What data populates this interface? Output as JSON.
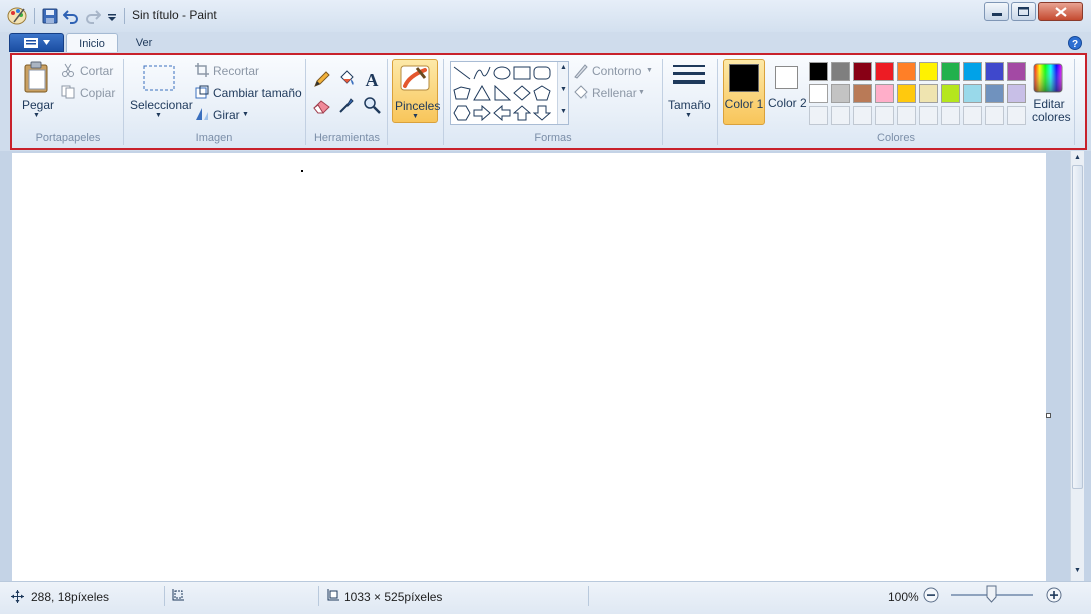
{
  "window": {
    "title": "Sin título - Paint",
    "minimize_icon": "minimize-icon",
    "maximize_icon": "maximize-icon",
    "close_icon": "close-icon"
  },
  "quick_access": [
    "save-icon",
    "undo-icon",
    "redo-icon",
    "customize-dropdown-icon"
  ],
  "tabs": [
    {
      "label": "Inicio",
      "active": true
    },
    {
      "label": "Ver",
      "active": false
    }
  ],
  "ribbon": {
    "portapapeles": {
      "label": "Portapapeles",
      "pegar": "Pegar",
      "cortar": "Cortar",
      "copiar": "Copiar"
    },
    "imagen": {
      "label": "Imagen",
      "seleccionar": "Seleccionar",
      "recortar": "Recortar",
      "cambiar_tamano": "Cambiar tamaño",
      "girar": "Girar"
    },
    "herramientas": {
      "label": "Herramientas",
      "tools": [
        "pencil-icon",
        "fill-bucket-icon",
        "text-icon",
        "eraser-icon",
        "color-picker-icon",
        "magnifier-icon"
      ]
    },
    "pinceles": {
      "label": "Pinceles"
    },
    "formas": {
      "label": "Formas",
      "contorno": "Contorno",
      "rellenar": "Rellenar",
      "shapes": [
        "line",
        "curve",
        "oval",
        "rectangle",
        "rounded-rectangle",
        "polygon",
        "triangle",
        "right-triangle",
        "diamond",
        "pentagon",
        "hexagon",
        "right-arrow",
        "left-arrow",
        "up-arrow",
        "down-arrow"
      ]
    },
    "tamano": {
      "label": "Tamaño"
    },
    "colores": {
      "label": "Colores",
      "color1": "Color 1",
      "color2": "Color 2",
      "editar": "Editar colores",
      "color1_value": "#000000",
      "color2_value": "#ffffff",
      "palette_row1": [
        "#000000",
        "#7f7f7f",
        "#880015",
        "#ed1c24",
        "#ff7f27",
        "#fff200",
        "#22b14c",
        "#00a2e8",
        "#3f48cc",
        "#a349a4"
      ],
      "palette_row2": [
        "#ffffff",
        "#c3c3c3",
        "#b97a57",
        "#ffaec9",
        "#ffc90e",
        "#efe4b0",
        "#b5e61d",
        "#99d9ea",
        "#7092be",
        "#c8bfe7"
      ]
    }
  },
  "status": {
    "cursor_pos": "288, 18píxeles",
    "canvas_size": "1033 × 525píxeles",
    "zoom": "100%"
  }
}
